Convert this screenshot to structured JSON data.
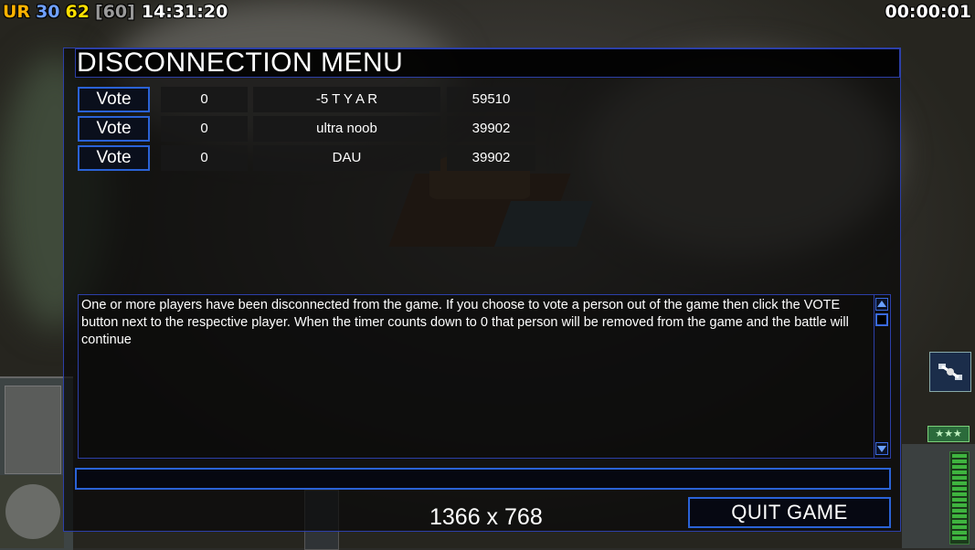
{
  "hud": {
    "faction": "UR",
    "value_blue": "30",
    "value_yellow": "62",
    "value_gray": "[60]",
    "clock": "14:31:20",
    "game_timer": "00:00:01"
  },
  "dialog": {
    "title": "DISCONNECTION MENU",
    "vote_label": "Vote",
    "players": [
      {
        "votes": "0",
        "name": "-5 T Y A R",
        "ping": "59510"
      },
      {
        "votes": "0",
        "name": "ultra noob",
        "ping": "39902"
      },
      {
        "votes": "0",
        "name": "DAU",
        "ping": "39902"
      }
    ],
    "message": "One or more players have been disconnected from the game. If you choose to vote a person out of the game then click the VOTE button next to the respective player. When the timer counts down to 0 that person will be removed from the game and the battle will continue",
    "chat_value": "",
    "quit_label": "QUIT GAME"
  },
  "overlay": {
    "resolution": "1366 x 768"
  },
  "icons": [
    "satellite-icon",
    "rank-stars-icon",
    "power-meter-icon",
    "scroll-up-icon",
    "scroll-down-icon"
  ],
  "colors": {
    "border_blue": "#2a62d6",
    "faction_orange": "#ffb300",
    "value_blue": "#6fa0ff",
    "value_yellow": "#ffe000"
  }
}
